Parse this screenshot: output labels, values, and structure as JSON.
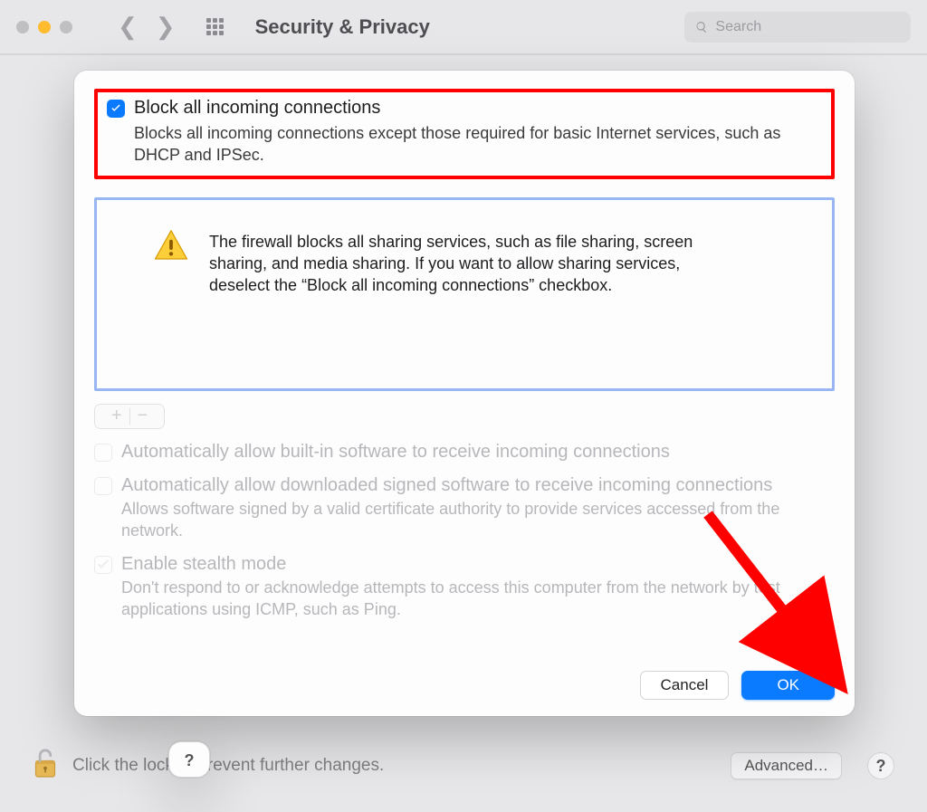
{
  "toolbar": {
    "title": "Security & Privacy",
    "search_placeholder": "Search"
  },
  "sheet": {
    "block_all": {
      "label": "Block all incoming connections",
      "desc": "Blocks all incoming connections except those required for basic Internet services, such as DHCP and IPSec."
    },
    "warning": "The firewall blocks all sharing services, such as file sharing, screen sharing, and media sharing. If you want to allow sharing services, deselect the “Block all incoming connections” checkbox.",
    "auto_builtin": {
      "label": "Automatically allow built-in software to receive incoming connections"
    },
    "auto_signed": {
      "label": "Automatically allow downloaded signed software to receive incoming connections",
      "desc": "Allows software signed by a valid certificate authority to provide services accessed from the network."
    },
    "stealth": {
      "label": "Enable stealth mode",
      "desc": "Don't respond to or acknowledge attempts to access this computer from the network by test applications using ICMP, such as Ping."
    },
    "help": "?",
    "cancel": "Cancel",
    "ok": "OK"
  },
  "lock": {
    "text": "Click the lock to prevent further changes.",
    "advanced": "Advanced…",
    "help": "?"
  }
}
